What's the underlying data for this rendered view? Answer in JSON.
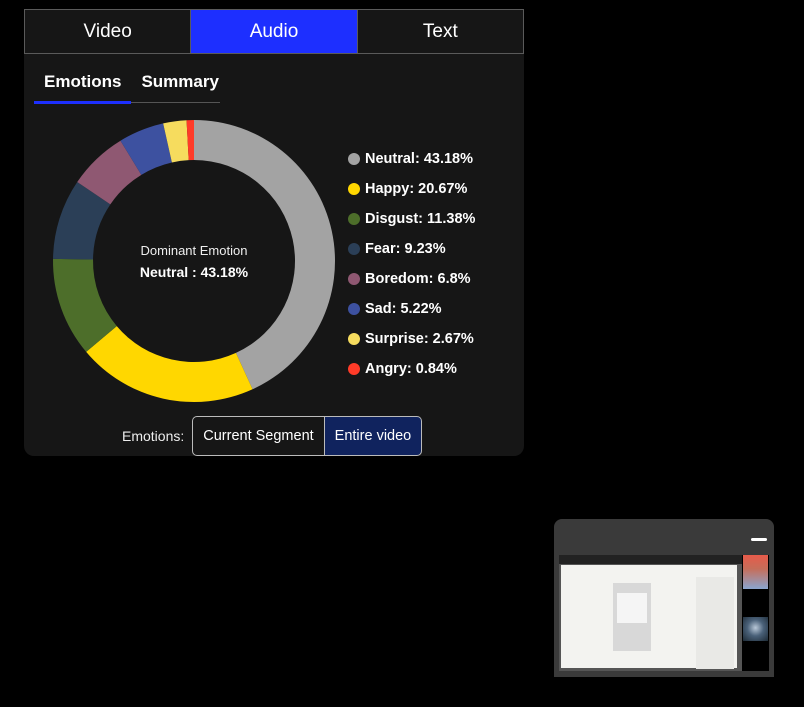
{
  "tabs": [
    "Video",
    "Audio",
    "Text"
  ],
  "active_tab": "Audio",
  "sub_tabs": [
    "Emotions",
    "Summary"
  ],
  "active_sub_tab": "Emotions",
  "center": {
    "label": "Dominant Emotion",
    "value": "Neutral : 43.18%"
  },
  "legend": [
    "Neutral: 43.18%",
    "Happy: 20.67%",
    "Disgust: 11.38%",
    "Fear: 9.23%",
    "Boredom: 6.8%",
    "Sad: 5.22%",
    "Surprise: 2.67%",
    "Angry: 0.84%"
  ],
  "toggle": {
    "label": "Emotions:",
    "options": [
      "Current Segment",
      "Entire video"
    ],
    "active": "Entire video"
  },
  "chart_data": {
    "type": "pie",
    "title": "",
    "categories": [
      "Neutral",
      "Happy",
      "Disgust",
      "Fear",
      "Boredom",
      "Sad",
      "Surprise",
      "Angry"
    ],
    "values": [
      43.18,
      20.67,
      11.38,
      9.23,
      6.8,
      5.22,
      2.67,
      0.84
    ],
    "colors": [
      "#a3a3a3",
      "#ffd700",
      "#4d6e2a",
      "#2b3f57",
      "#8f5872",
      "#3d51a0",
      "#f6dc5e",
      "#ff3b28"
    ],
    "donut": true
  }
}
